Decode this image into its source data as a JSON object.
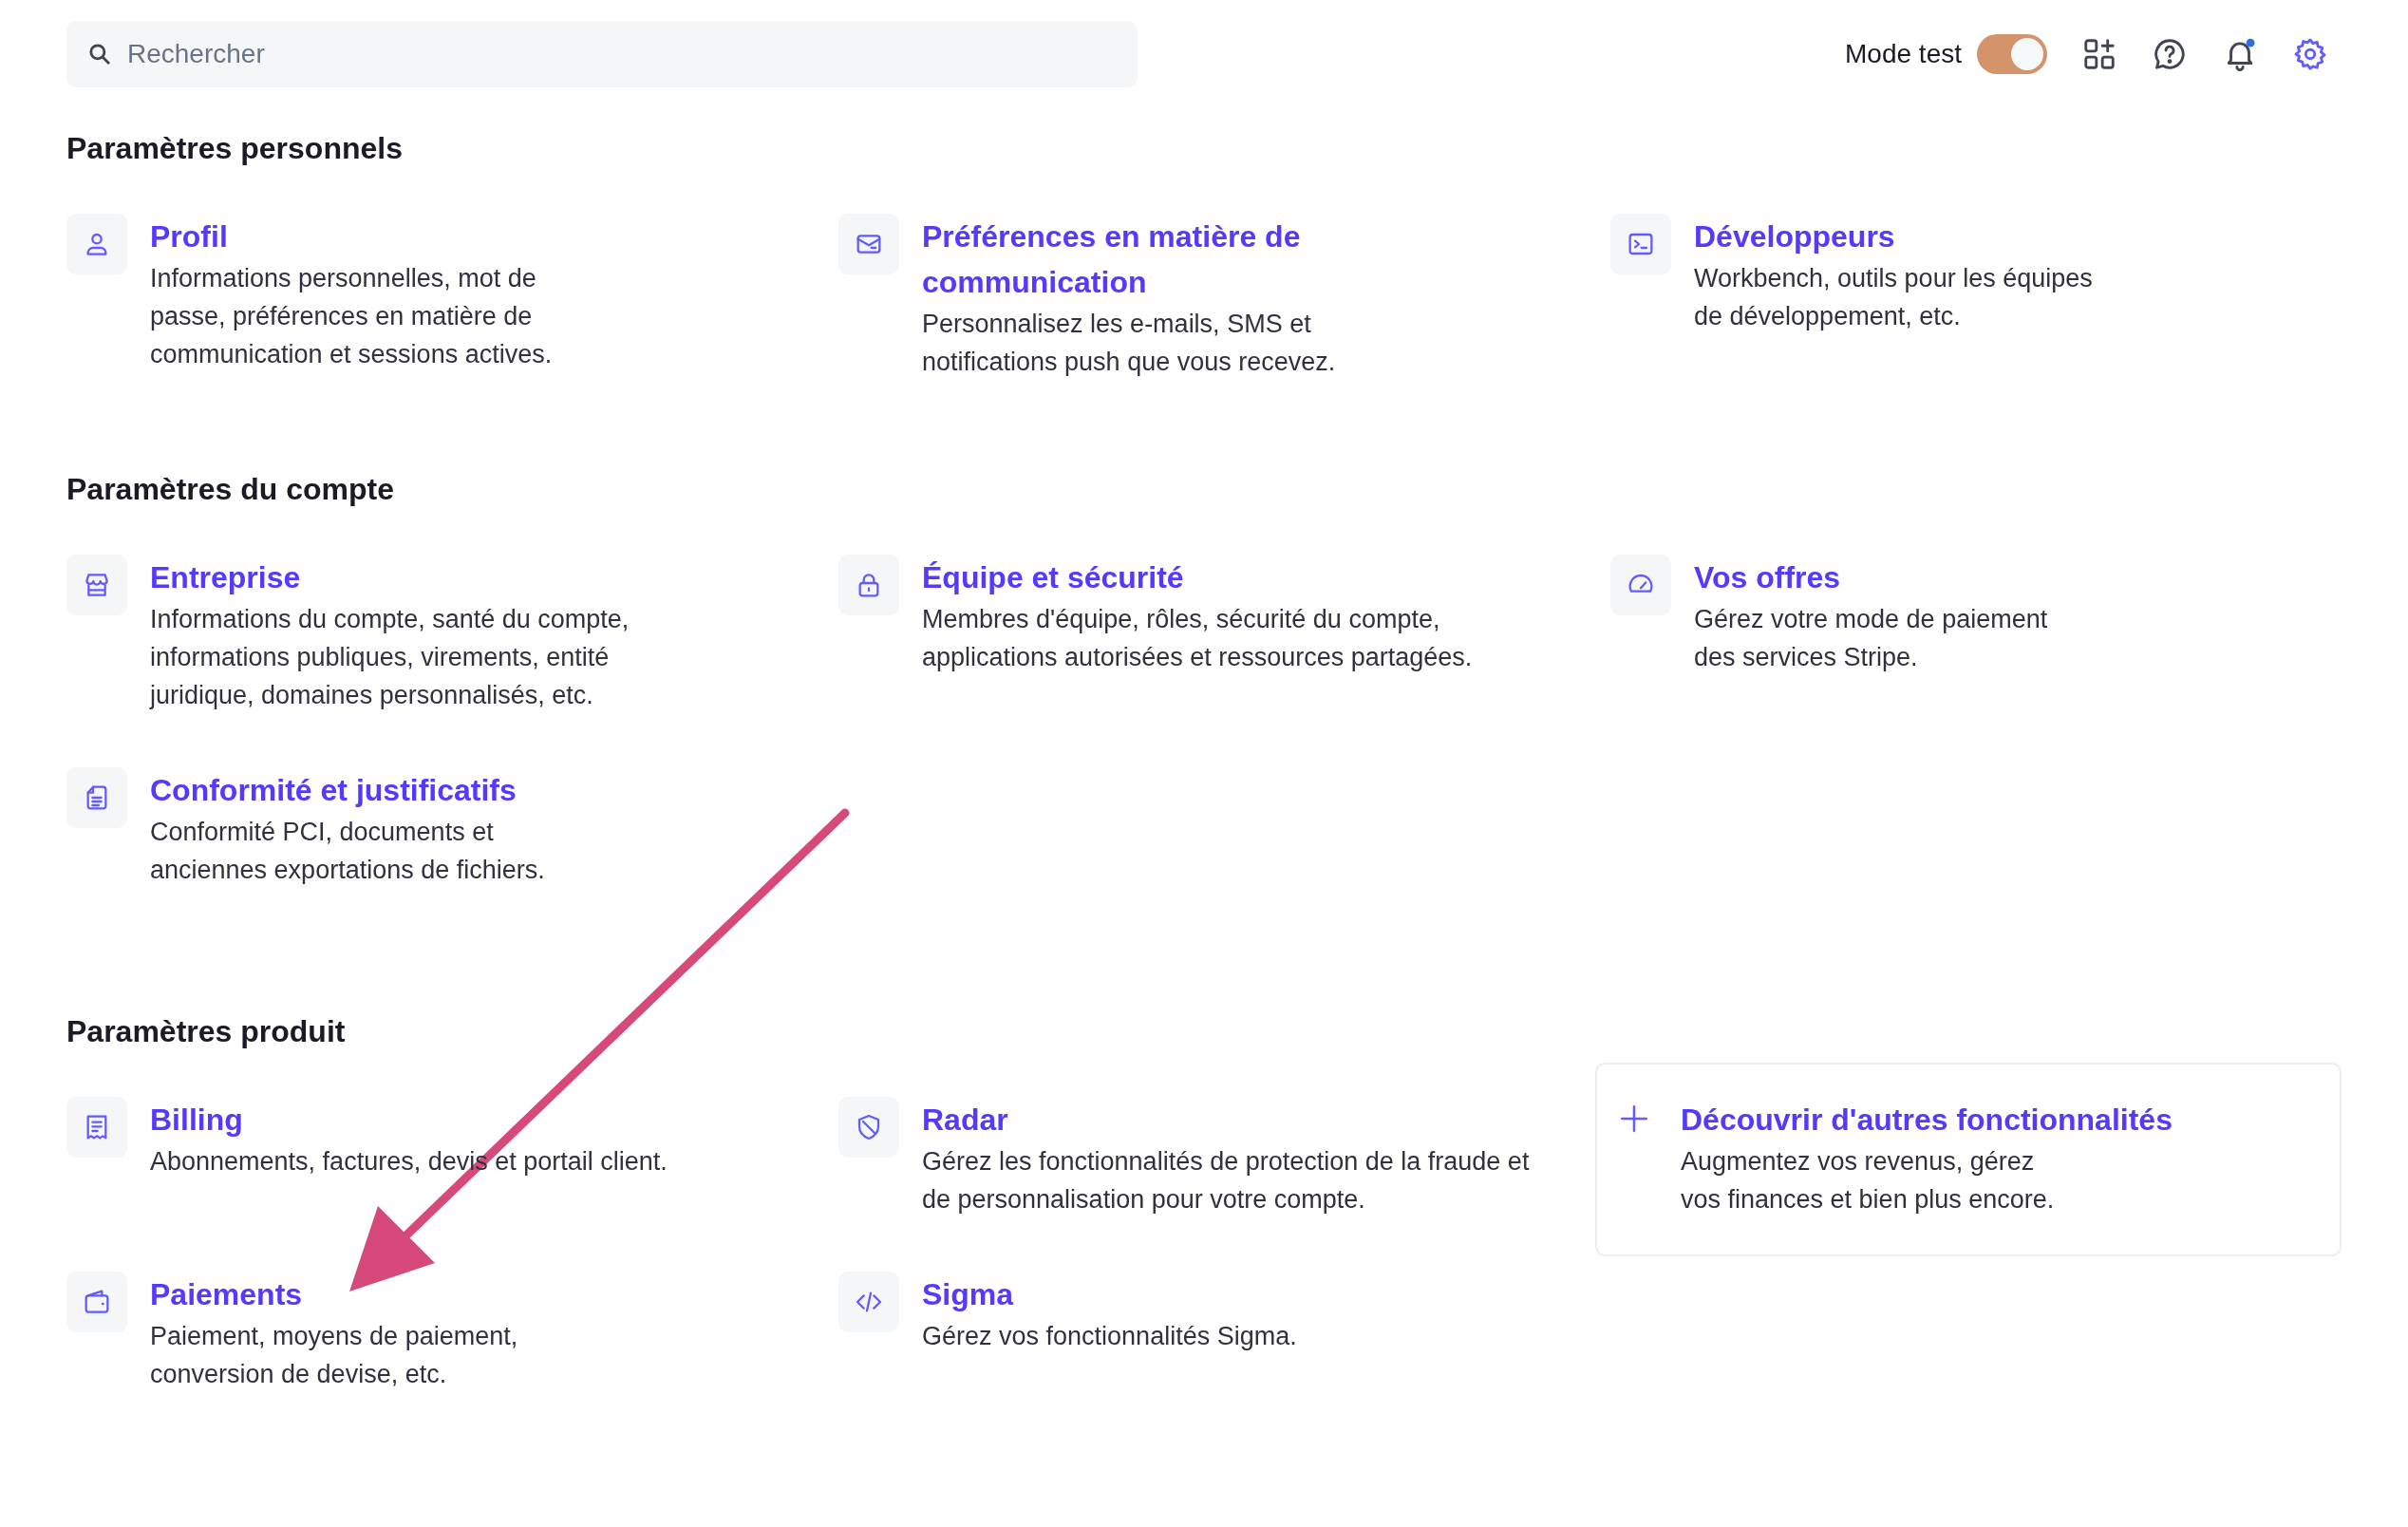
{
  "search": {
    "placeholder": "Rechercher"
  },
  "toolbar": {
    "mode_label": "Mode test",
    "mode_on": true,
    "icons": [
      {
        "kind": "apps",
        "selected": false
      },
      {
        "kind": "help",
        "selected": false
      },
      {
        "kind": "bell",
        "selected": false,
        "unread": true
      },
      {
        "kind": "gear",
        "selected": true
      }
    ]
  },
  "sections": [
    {
      "title": "Paramètres personnels",
      "items": [
        {
          "kind": "person",
          "title": "Profil",
          "description": "Informations personnelles, mot de passe, préférences en matière de communication et sessions actives."
        },
        {
          "kind": "mail",
          "title": "Préférences en matière de communication",
          "description": "Personnalisez les e-mails, SMS et notifications push que vous recevez."
        },
        {
          "kind": "terminal",
          "title": "Développeurs",
          "description": "Workbench, outils pour les équipes de développement, etc."
        }
      ]
    },
    {
      "title": "Paramètres du compte",
      "items": [
        {
          "kind": "store",
          "title": "Entreprise",
          "description": "Informations du compte, santé du compte, informations publiques, virements, entité juridique, domaines personnalisés, etc."
        },
        {
          "kind": "lock",
          "title": "Équipe et sécurité",
          "description": "Membres d'équipe, rôles, sécurité du compte, applications autorisées et ressources partagées."
        },
        {
          "kind": "gauge",
          "title": "Vos offres",
          "description": "Gérez votre mode de paiement des services Stripe."
        },
        {
          "kind": "document",
          "title": "Conformité et justificatifs",
          "description": "Conformité PCI, documents et anciennes exportations de fichiers."
        }
      ]
    },
    {
      "title": "Paramètres produit",
      "items": [
        {
          "kind": "receipt",
          "title": "Billing",
          "description": "Abonnements, factures, devis et portail client."
        },
        {
          "kind": "shield",
          "title": "Radar",
          "description": "Gérez les fonctionnalités de protection de la fraude et de personnalisation pour votre compte."
        },
        {
          "kind": "discover",
          "title": "Découvrir d'autres fonctionnalités",
          "description": "Augmentez vos revenus, gérez vos finances et bien plus encore."
        },
        {
          "kind": "wallet",
          "title": "Paiements",
          "description": "Paiement, moyens de paiement, conversion de devise, etc."
        },
        {
          "kind": "code",
          "title": "Sigma",
          "description": "Gérez vos fonctionnalités Sigma."
        }
      ]
    }
  ]
}
